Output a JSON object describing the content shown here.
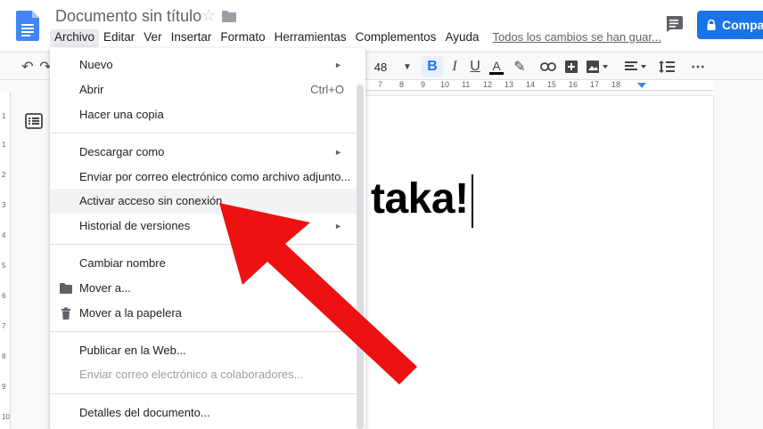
{
  "header": {
    "doc_title": "Documento sin título",
    "share_label": "Compartir"
  },
  "menubar": {
    "items": [
      "Archivo",
      "Editar",
      "Ver",
      "Insertar",
      "Formato",
      "Herramientas",
      "Complementos",
      "Ayuda"
    ],
    "saved_status": "Todos los cambios se han guar..."
  },
  "toolbar": {
    "font_size": "48"
  },
  "ruler": {
    "marks": [
      "7",
      "8",
      "9",
      "10",
      "11",
      "12",
      "13",
      "14",
      "15",
      "16",
      "17",
      "18"
    ],
    "vmarks": [
      "1",
      "1",
      "2",
      "3",
      "4",
      "5",
      "6",
      "7",
      "8",
      "9",
      "10"
    ]
  },
  "document": {
    "visible_text": "taka!"
  },
  "file_menu": {
    "items": [
      {
        "label": "Nuevo",
        "submenu": true
      },
      {
        "label": "Abrir",
        "shortcut": "Ctrl+O"
      },
      {
        "label": "Hacer una copia"
      },
      {
        "label": "Descargar como",
        "submenu": true
      },
      {
        "label": "Enviar por correo electrónico como archivo adjunto..."
      },
      {
        "label": "Activar acceso sin conexión",
        "highlighted": true
      },
      {
        "label": "Historial de versiones",
        "submenu": true
      },
      {
        "label": "Cambiar nombre"
      },
      {
        "label": "Mover a...",
        "icon": "folder-icon"
      },
      {
        "label": "Mover a la papelera",
        "icon": "trash-icon"
      },
      {
        "label": "Publicar en la Web..."
      },
      {
        "label": "Enviar correo electrónico a colaboradores...",
        "disabled": true
      },
      {
        "label": "Detalles del documento..."
      }
    ]
  },
  "colors": {
    "accent": "#1a73e8",
    "arrow": "#ee1111"
  }
}
